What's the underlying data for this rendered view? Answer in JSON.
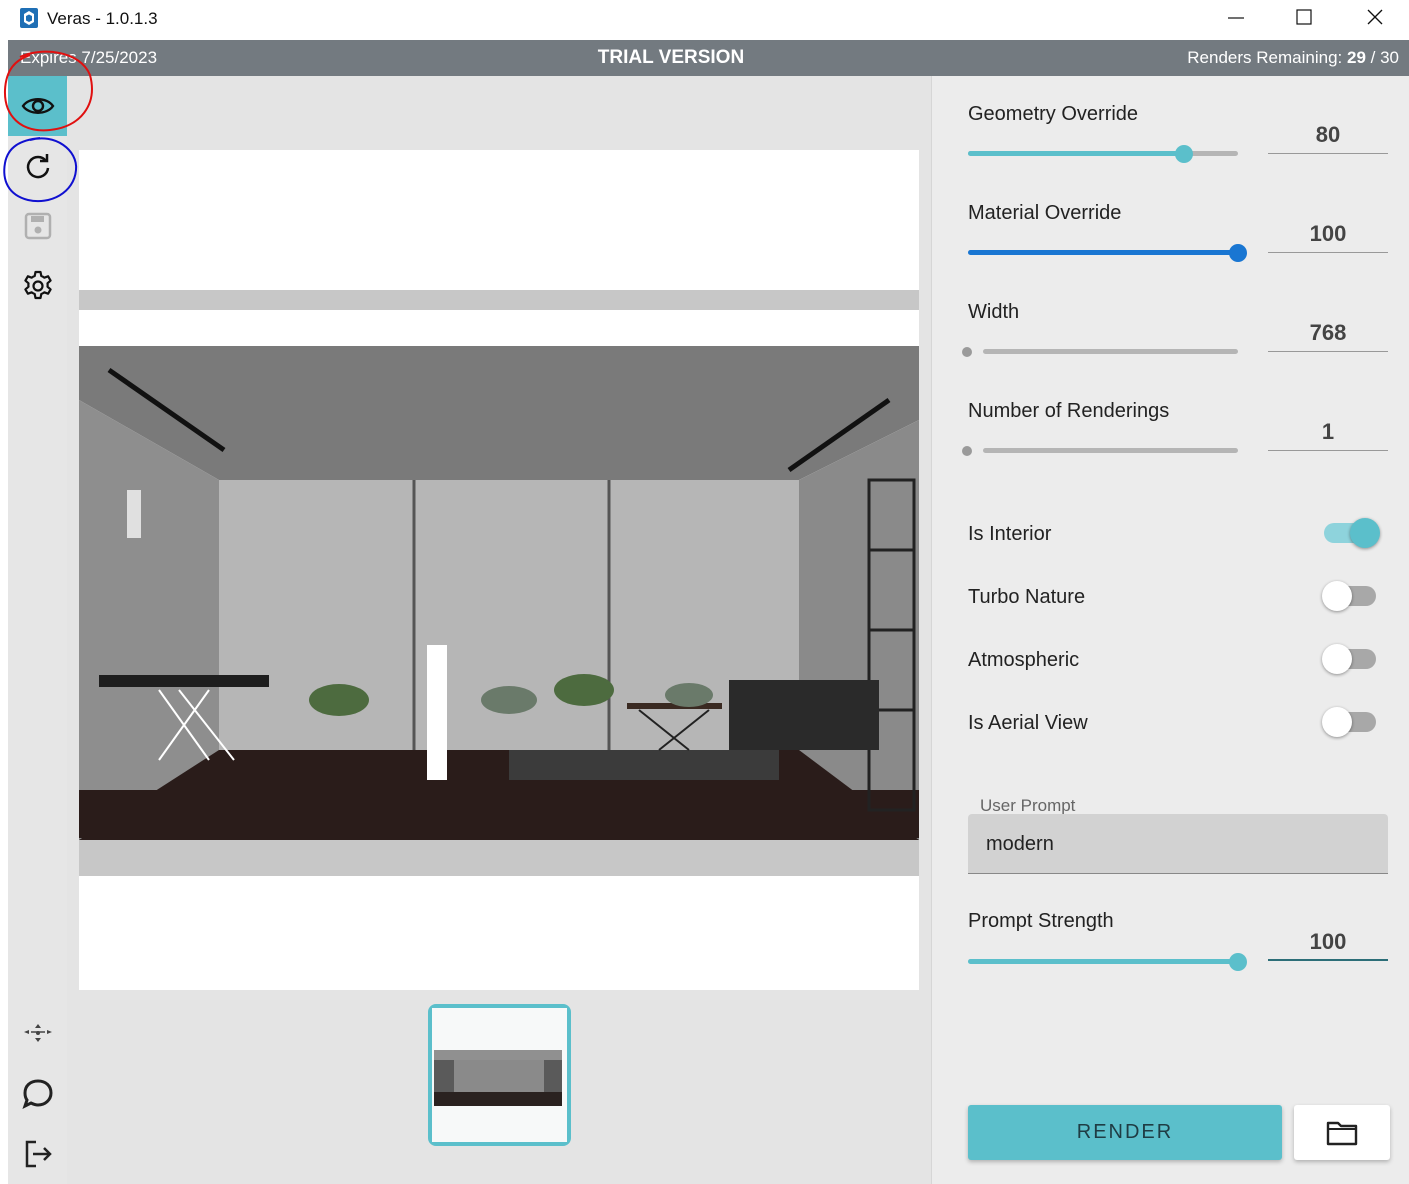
{
  "window": {
    "title": "Veras - 1.0.1.3",
    "controls": [
      "minimize",
      "maximize",
      "close"
    ]
  },
  "banner": {
    "expires": "Expires 7/25/2023",
    "trial": "TRIAL VERSION",
    "renders_label": "Renders Remaining:",
    "renders_used": "29",
    "renders_total": " / 30"
  },
  "sidebar": {
    "top_icons": [
      "eye-icon",
      "refresh-icon",
      "save-icon",
      "gear-icon"
    ],
    "bottom_icons": [
      "network-icon",
      "chat-icon",
      "logout-icon"
    ],
    "active": "eye-icon"
  },
  "settings": {
    "geometry_override": {
      "label": "Geometry Override",
      "value": "80",
      "fraction": 0.8
    },
    "material_override": {
      "label": "Material Override",
      "value": "100",
      "fraction": 1.0
    },
    "width": {
      "label": "Width",
      "value": "768",
      "fraction": 0.0
    },
    "num_renderings": {
      "label": "Number of Renderings",
      "value": "1",
      "fraction": 0.0
    },
    "toggles": [
      {
        "label": "Is Interior",
        "on": true
      },
      {
        "label": "Turbo Nature",
        "on": false
      },
      {
        "label": "Atmospheric",
        "on": false
      },
      {
        "label": "Is Aerial View",
        "on": false
      }
    ],
    "user_prompt": {
      "label": "User Prompt",
      "value": "modern"
    },
    "prompt_strength": {
      "label": "Prompt Strength",
      "value": "100",
      "fraction": 1.0
    },
    "render_button": "RENDER",
    "folder_button_icon": "folder-icon"
  },
  "colors": {
    "accent": "#5bbfcb",
    "accent_blue": "#1976d2",
    "banner": "#737a80"
  }
}
